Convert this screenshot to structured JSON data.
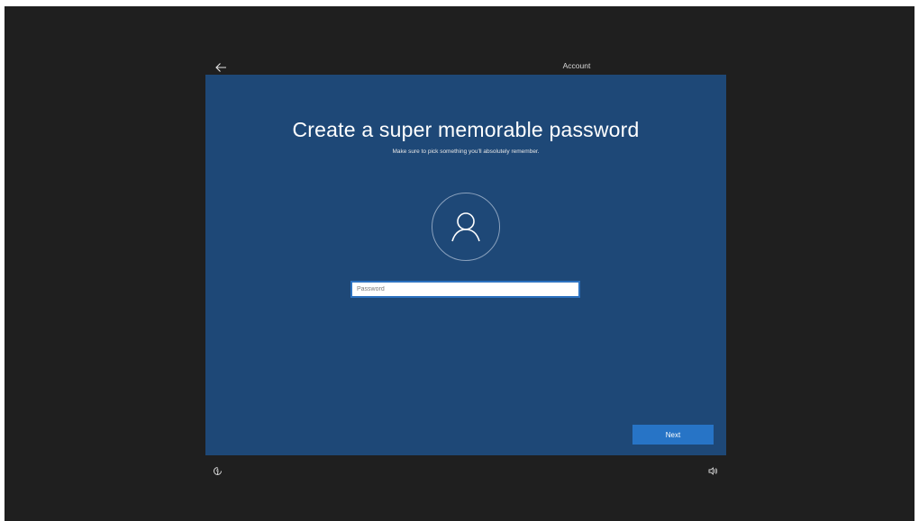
{
  "header": {
    "active_tab": "Account"
  },
  "main": {
    "title": "Create a super memorable password",
    "subtitle": "Make sure to pick something you'll absolutely remember.",
    "password": {
      "placeholder": "Password",
      "value": ""
    },
    "next_label": "Next"
  },
  "icons": {
    "back": "arrow-left-icon",
    "avatar": "person-icon",
    "accessibility": "ease-of-access-icon",
    "volume": "speaker-icon"
  },
  "colors": {
    "background": "#1f1f1f",
    "panel": "#1e4877",
    "accent": "#2774c6"
  }
}
